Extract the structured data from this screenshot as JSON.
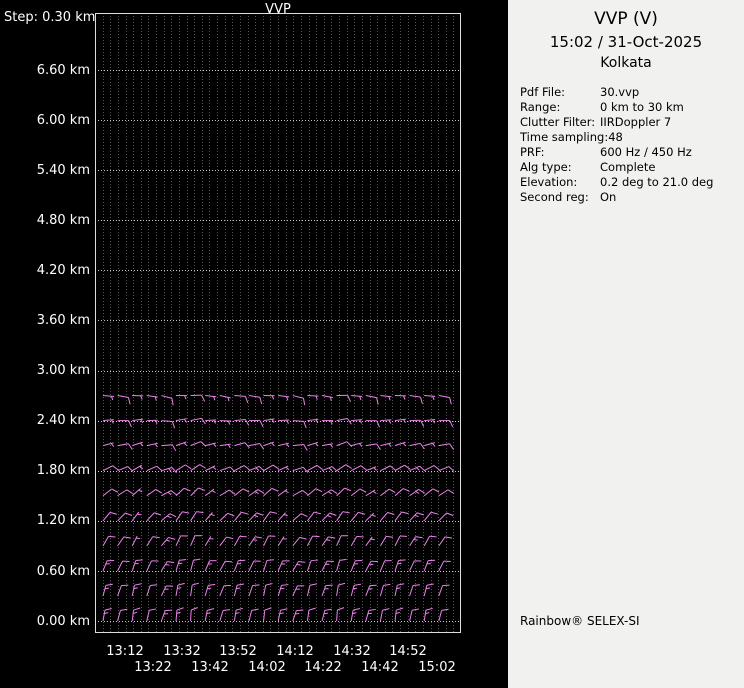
{
  "left_panel": {
    "plot_title": "VVP",
    "step_label": "Step: 0.30 km",
    "y_labels": [
      "6.60 km",
      "6.00 km",
      "5.40 km",
      "4.80 km",
      "4.20 km",
      "3.60 km",
      "3.00 km",
      "2.40 km",
      "1.80 km",
      "1.20 km",
      "0.60 km",
      "0.00 km"
    ],
    "x_labels_row1": [
      "13:12",
      "13:32",
      "13:52",
      "14:12",
      "14:32",
      "14:52"
    ],
    "x_labels_row2": [
      "13:22",
      "13:42",
      "14:02",
      "14:22",
      "14:42",
      "15:02"
    ]
  },
  "info_panel": {
    "title": "VVP (V)",
    "datetime": "15:02 / 31-Oct-2025",
    "site": "Kolkata",
    "params": [
      {
        "label": "Pdf File:",
        "value": "30.vvp"
      },
      {
        "label": "Range:",
        "value": "0 km to 30 km"
      },
      {
        "label": "Clutter Filter:",
        "value": "IIRDoppler 7"
      },
      {
        "label": "Time sampling:",
        "value": "48"
      },
      {
        "label": "PRF:",
        "value": "600 Hz / 450 Hz"
      },
      {
        "label": "Alg type:",
        "value": "Complete"
      },
      {
        "label": "Elevation:",
        "value": "0.2 deg to 21.0 deg"
      },
      {
        "label": "Second reg:",
        "value": "On"
      }
    ],
    "footer": "Rainbow® SELEX-SI"
  },
  "chart_data": {
    "type": "wind-barb-profile",
    "title": "VVP",
    "xlabel": "time (13:12 to 15:02, labels every 10 min)",
    "ylabel": "altitude (0.00 km to 6.60 km, labels every 0.60 km)",
    "altitude_step_km": 0.3,
    "time_columns": 24,
    "barb_color": "#ee82ee",
    "grid_vertical_intervals": 48,
    "grid_horizontal_lines_km": [
      0.0,
      0.6,
      1.2,
      1.8,
      2.4,
      3.0,
      3.6,
      4.2,
      4.8,
      5.4,
      6.0,
      6.6
    ],
    "dir_wiggle": [
      0,
      5,
      -3,
      3,
      10,
      -5,
      -7,
      1,
      7,
      -1,
      4,
      -4,
      2,
      9,
      -2,
      5,
      -6,
      0,
      6,
      1,
      -3,
      3,
      -1,
      5
    ],
    "spd_patterns": {
      "A": [
        15,
        10,
        15,
        10,
        15,
        15,
        10,
        15,
        10,
        15,
        10,
        10,
        15,
        15,
        10,
        15,
        10,
        15,
        15,
        10,
        15,
        10,
        15,
        10
      ],
      "B": [
        10,
        10,
        5,
        10,
        15,
        10,
        10,
        5,
        10,
        10,
        15,
        10,
        5,
        10,
        10,
        15,
        10,
        10,
        5,
        10,
        10,
        15,
        10,
        10
      ],
      "C": [
        5,
        10,
        5,
        5,
        10,
        5,
        10,
        5,
        5,
        10,
        10,
        5,
        5,
        10,
        5,
        5,
        10,
        5,
        10,
        5,
        5,
        10,
        5,
        10
      ]
    },
    "rows": [
      {
        "alt": 0.0,
        "dir_base": 10,
        "spd": "A"
      },
      {
        "alt": 0.3,
        "dir_base": 15,
        "spd": "A"
      },
      {
        "alt": 0.6,
        "dir_base": 22,
        "spd": "A"
      },
      {
        "alt": 0.9,
        "dir_base": 30,
        "spd": "B"
      },
      {
        "alt": 1.2,
        "dir_base": 40,
        "spd": "B"
      },
      {
        "alt": 1.5,
        "dir_base": 52,
        "spd": "B"
      },
      {
        "alt": 1.8,
        "dir_base": 63,
        "spd": "B"
      },
      {
        "alt": 2.1,
        "dir_base": 75,
        "spd": "C"
      },
      {
        "alt": 2.4,
        "dir_base": 85,
        "spd": "C"
      },
      {
        "alt": 2.7,
        "dir_base": 95,
        "spd": "C"
      }
    ]
  }
}
